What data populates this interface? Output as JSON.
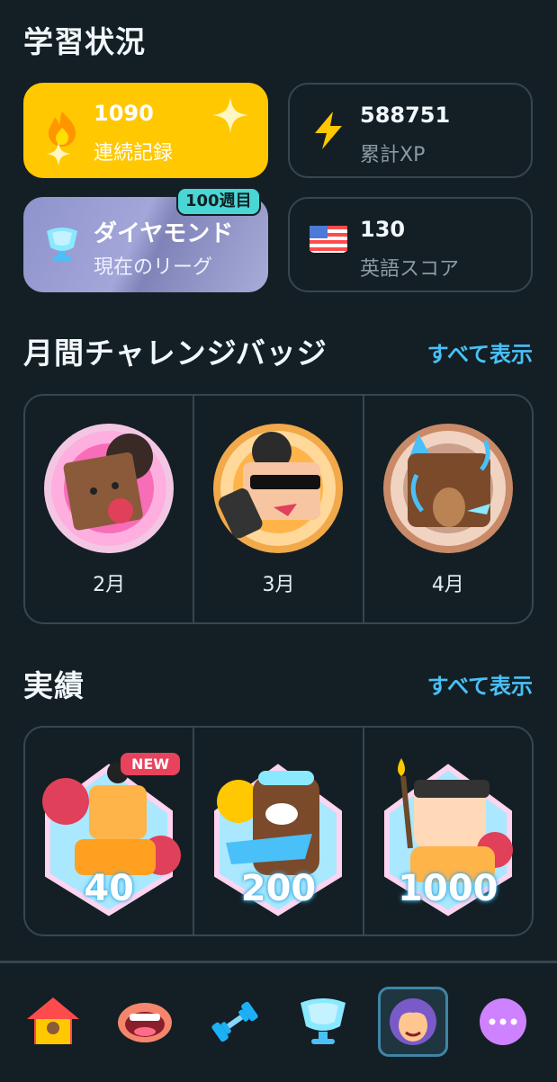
{
  "header": {
    "title": "学習状況"
  },
  "stats": {
    "streak": {
      "value": "1090",
      "label": "連続記録"
    },
    "xp": {
      "value": "588751",
      "label": "累計XP"
    },
    "league": {
      "value": "ダイヤモンド",
      "label": "現在のリーグ",
      "badge": "100週目"
    },
    "score": {
      "value": "130",
      "label": "英語スコア"
    }
  },
  "monthly": {
    "title": "月間チャレンジバッジ",
    "see_all": "すべて表示",
    "badges": [
      {
        "month": "2月"
      },
      {
        "month": "3月"
      },
      {
        "month": "4月"
      }
    ]
  },
  "achievements": {
    "title": "実績",
    "see_all": "すべて表示",
    "items": [
      {
        "value": "40",
        "tag": "NEW"
      },
      {
        "value": "200"
      },
      {
        "value": "1000"
      }
    ]
  },
  "nav": {
    "items": [
      "home-icon",
      "characters-icon",
      "practice-icon",
      "leagues-icon",
      "profile-icon",
      "more-icon"
    ],
    "selected": "profile-icon"
  },
  "colors": {
    "background": "#131f24",
    "streak_card": "#ffc800",
    "league_card": "#8e93cc",
    "accent_link": "#49c0f8",
    "border": "#37464f"
  }
}
